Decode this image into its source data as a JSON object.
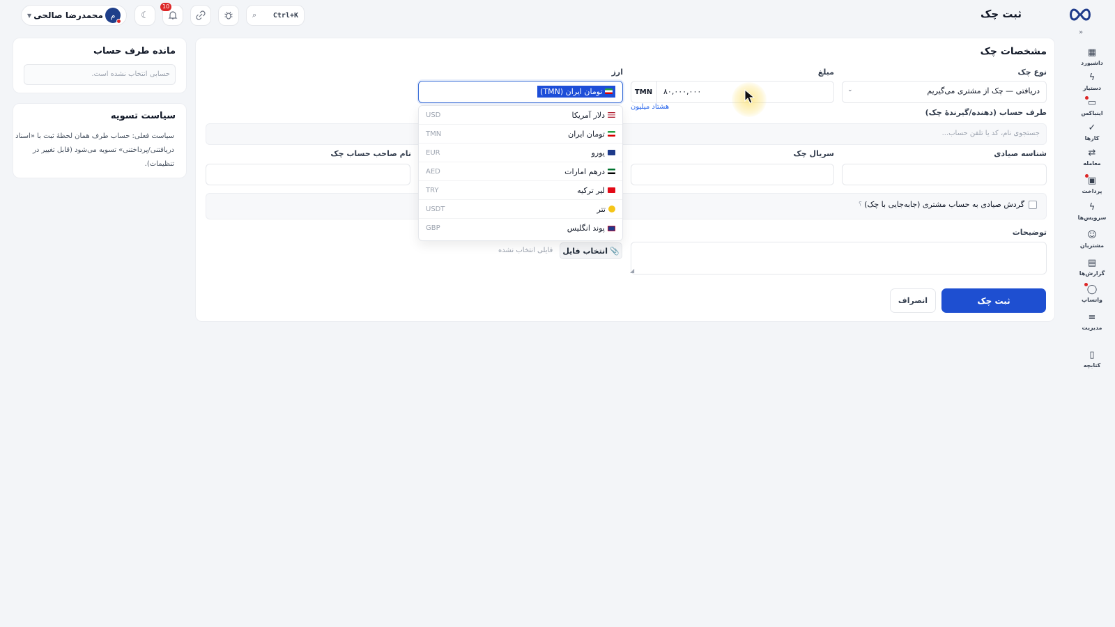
{
  "header": {
    "page_title": "ثبت چک",
    "user_name": "محمدرضا صالحی",
    "avatar_initial": "م",
    "notification_count": "10",
    "shortcut": "Ctrl+K"
  },
  "sidebar": {
    "items": [
      {
        "label": "داشبورد",
        "icon": "dashboard-icon"
      },
      {
        "label": "دستیار",
        "icon": "bolt-icon"
      },
      {
        "label": "اینباکس",
        "icon": "inbox-icon"
      },
      {
        "label": "کارها",
        "icon": "check-icon"
      },
      {
        "label": "معامله",
        "icon": "exchange-icon"
      },
      {
        "label": "پرداخت",
        "icon": "payment-icon"
      },
      {
        "label": "سرویس‌ها",
        "icon": "services-icon"
      },
      {
        "label": "مشتریان",
        "icon": "customers-icon"
      },
      {
        "label": "گزارش‌ها",
        "icon": "reports-icon"
      },
      {
        "label": "واتساپ",
        "icon": "whatsapp-icon"
      },
      {
        "label": "مدیریت",
        "icon": "settings-icon"
      },
      {
        "label": "کتابچه",
        "icon": "book-icon"
      }
    ]
  },
  "form": {
    "title": "مشخصات چک",
    "check_type_label": "نوع چک",
    "check_type_value": "دریافتی — چک از مشتری می‌گیریم",
    "amount_label": "مبلغ",
    "amount_value": "۸۰,۰۰۰,۰۰۰",
    "amount_unit": "TMN",
    "amount_words": "هشتاد میلیون",
    "currency_label": "ارز",
    "currency_value": "تومان ایران (TMN)",
    "counterparty_label": "طرف حساب (دهنده/گیرندهٔ چک)",
    "counterparty_placeholder": "جستجوی نام، کد یا تلفن حساب...",
    "sayadi_label": "شناسه صیادی",
    "serial_label": "سریال چک",
    "owner_label": "نام صاحب حساب چک",
    "transfer_label": "گردش صیادی به حساب مشتری (جابه‌جایی با چک)",
    "transfer_help": "؟",
    "notes_label": "توضیحات",
    "file_button": "انتخاب فایل",
    "file_status": "فایلی انتخاب نشده",
    "submit_label": "ثبت چک",
    "cancel_label": "انصراف"
  },
  "currency_options": [
    {
      "name": "دلار آمریکا",
      "code": "USD"
    },
    {
      "name": "تومان ایران",
      "code": "TMN"
    },
    {
      "name": "یورو",
      "code": "EUR"
    },
    {
      "name": "درهم امارات",
      "code": "AED"
    },
    {
      "name": "لیر ترکیه",
      "code": "TRY"
    },
    {
      "name": "تتر",
      "code": "USDT"
    },
    {
      "name": "پوند انگلیس",
      "code": "GBP"
    }
  ],
  "balance_card": {
    "title": "مانده طرف حساب",
    "placeholder": "حسابی انتخاب نشده است."
  },
  "policy_card": {
    "title": "سیاست تسویه",
    "text": "سیاست فعلی: حساب طرف همان لحظهٔ ثبت با «اسناد دریافتنی/پرداختنی» تسویه می‌شود (قابل تغییر در تنظیمات)."
  },
  "colors": {
    "primary": "#1e4fd1",
    "accent_link": "#2563eb",
    "badge": "#dc2626"
  }
}
